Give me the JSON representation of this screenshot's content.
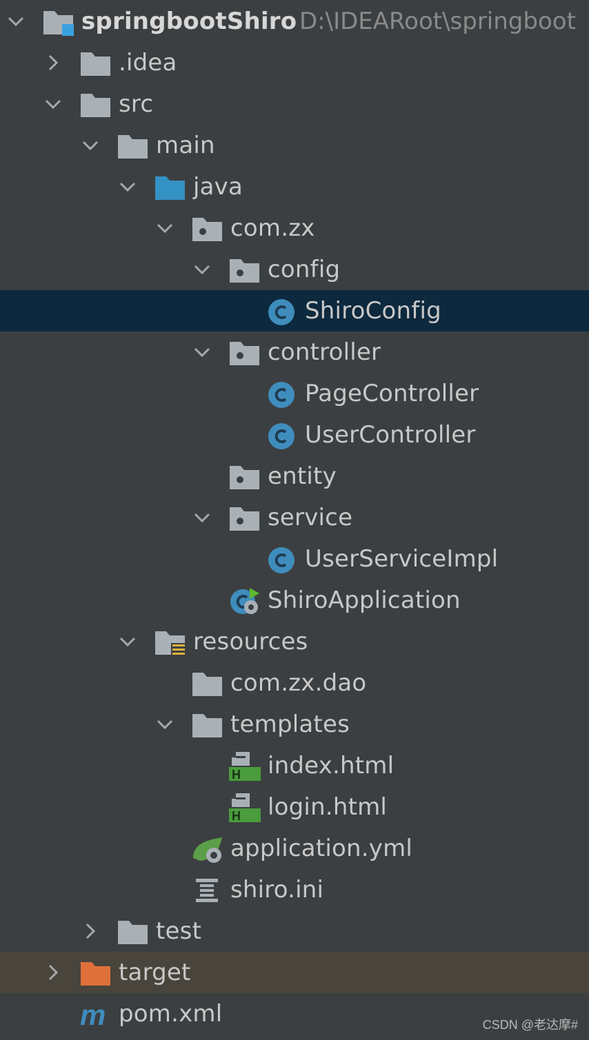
{
  "project": {
    "name": "springbootShiro",
    "path": "D:\\IDEARoot\\springboot"
  },
  "tree": {
    "idea": ".idea",
    "src": "src",
    "main": "main",
    "java": "java",
    "com_zx": "com.zx",
    "config": "config",
    "shiro_config": "ShiroConfig",
    "controller": "controller",
    "page_controller": "PageController",
    "user_controller": "UserController",
    "entity": "entity",
    "service": "service",
    "user_service_impl": "UserServiceImpl",
    "shiro_application": "ShiroApplication",
    "resources": "resources",
    "com_zx_dao": "com.zx.dao",
    "templates": "templates",
    "index_html": "index.html",
    "login_html": "login.html",
    "application_yml": "application.yml",
    "shiro_ini": "shiro.ini",
    "test": "test",
    "target": "target",
    "pom_xml": "pom.xml"
  },
  "watermark": "CSDN @老达摩#",
  "colors": {
    "background": "#3c3f41",
    "selected_row": "#0d293e",
    "excluded_row": "#49453c",
    "folder": "#a9b1b7",
    "source_folder": "#3592c4",
    "excluded_folder": "#e0703a",
    "class_icon": "#3f8dbd",
    "html_badge": "#4a9c3c"
  }
}
